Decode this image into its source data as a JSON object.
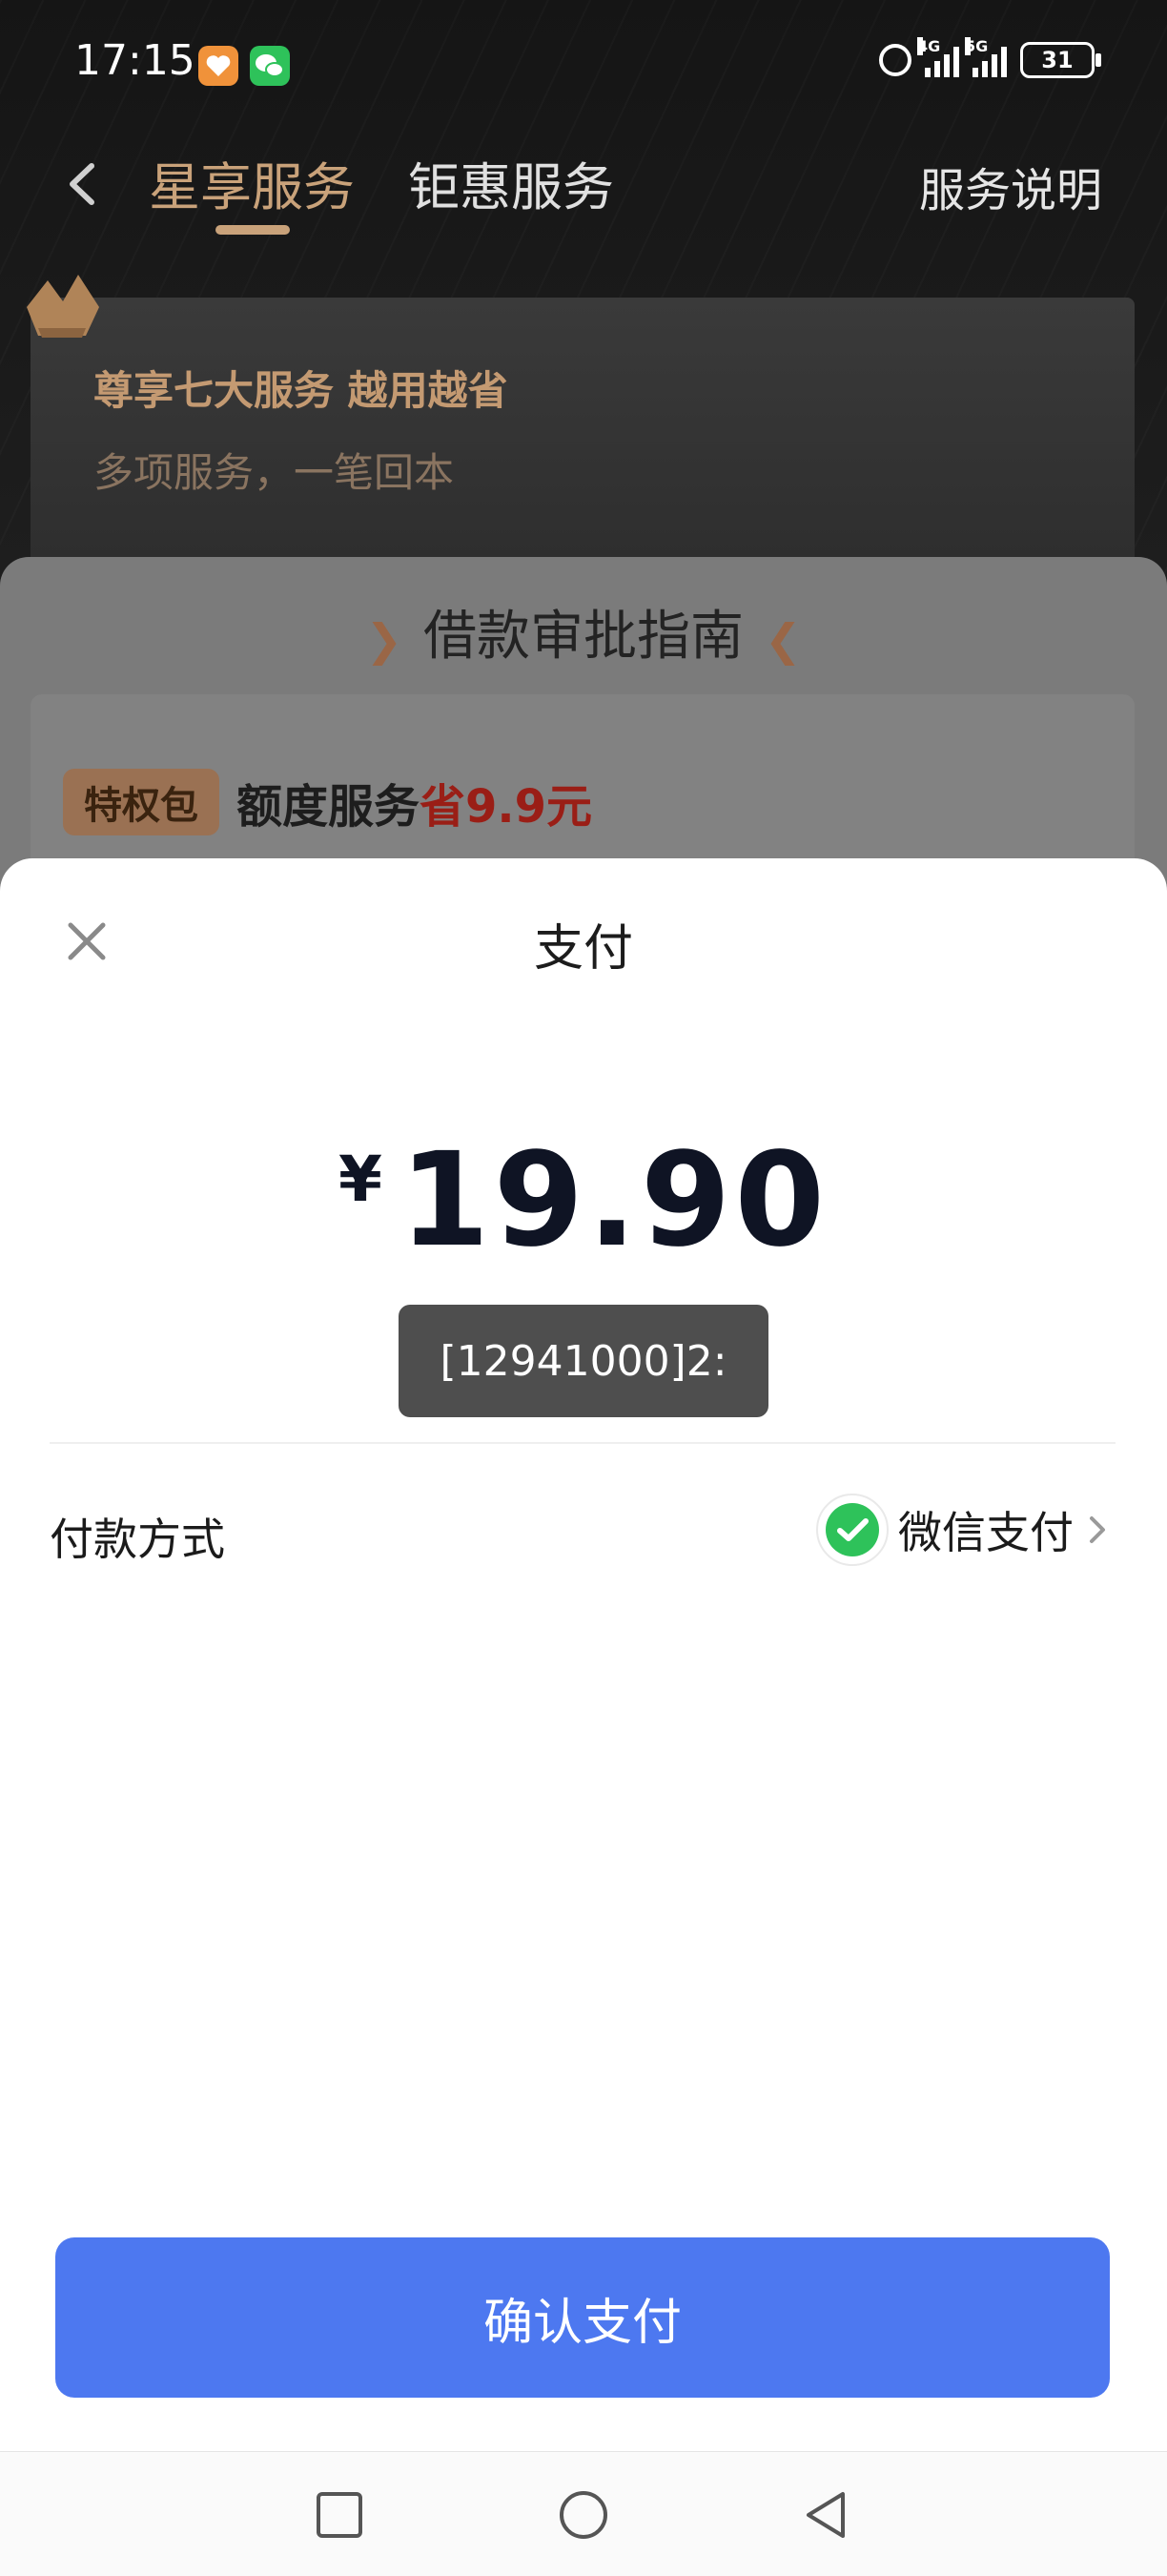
{
  "status_bar": {
    "time": "17:15",
    "signal_1": "4G",
    "signal_2": "5G",
    "battery": "31"
  },
  "header": {
    "tabs": [
      {
        "label": "星享服务",
        "active": true
      },
      {
        "label": "钜惠服务",
        "active": false
      }
    ],
    "service_desc": "服务说明"
  },
  "gold_card": {
    "title": "尊享七大服务 越用越省",
    "subtitle": "多项服务，一笔回本"
  },
  "guide": {
    "title": "借款审批指南"
  },
  "package": {
    "badge": "特权包",
    "text": "额度服务",
    "highlight": "省9.9元"
  },
  "payment": {
    "title": "支付",
    "currency": "¥",
    "amount": "19.90",
    "toast": "[12941000]2:",
    "method_label": "付款方式",
    "method_value": "微信支付",
    "confirm_label": "确认支付"
  },
  "colors": {
    "accent_gold": "#c9a27a",
    "primary_blue": "#4d78f0",
    "price_red": "#9a1e16",
    "wechat_green": "#2ec25a"
  }
}
